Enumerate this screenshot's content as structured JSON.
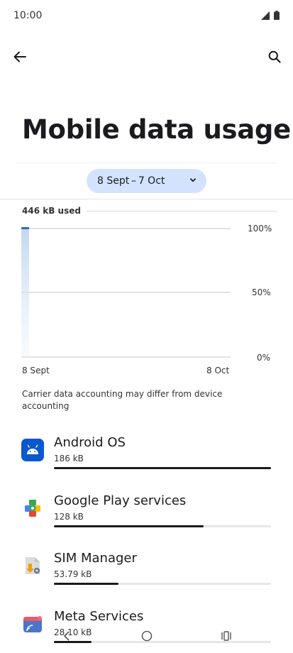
{
  "status_bar": {
    "time": "10:00"
  },
  "page": {
    "title": "Mobile data usage"
  },
  "cycle": {
    "label": "8 Sept – 7 Oct"
  },
  "usage": {
    "used_label": "446 kB used"
  },
  "chart_data": {
    "type": "area",
    "x_labels": [
      "8 Sept",
      "8 Oct"
    ],
    "y_ticks": [
      "100%",
      "50%",
      "0%"
    ],
    "ylim": [
      0,
      100
    ],
    "series": [
      {
        "values": [
          100
        ]
      }
    ]
  },
  "disclaimer": "Carrier data accounting may differ from device accounting",
  "apps": [
    {
      "name": "Android OS",
      "size": "186 kB",
      "fraction": 1.0,
      "icon": "android-os-icon"
    },
    {
      "name": "Google Play services",
      "size": "128 kB",
      "fraction": 0.688,
      "icon": "google-play-services-icon"
    },
    {
      "name": "SIM Manager",
      "size": "53.79 kB",
      "fraction": 0.299,
      "icon": "sim-manager-icon"
    },
    {
      "name": "Meta Services",
      "size": "28.10 kB",
      "fraction": 0.173,
      "icon": "meta-services-icon"
    }
  ],
  "colors": {
    "accent": "#d3e3fd",
    "android_blue": "#0b57d0",
    "bar": "#1b1b1f"
  }
}
